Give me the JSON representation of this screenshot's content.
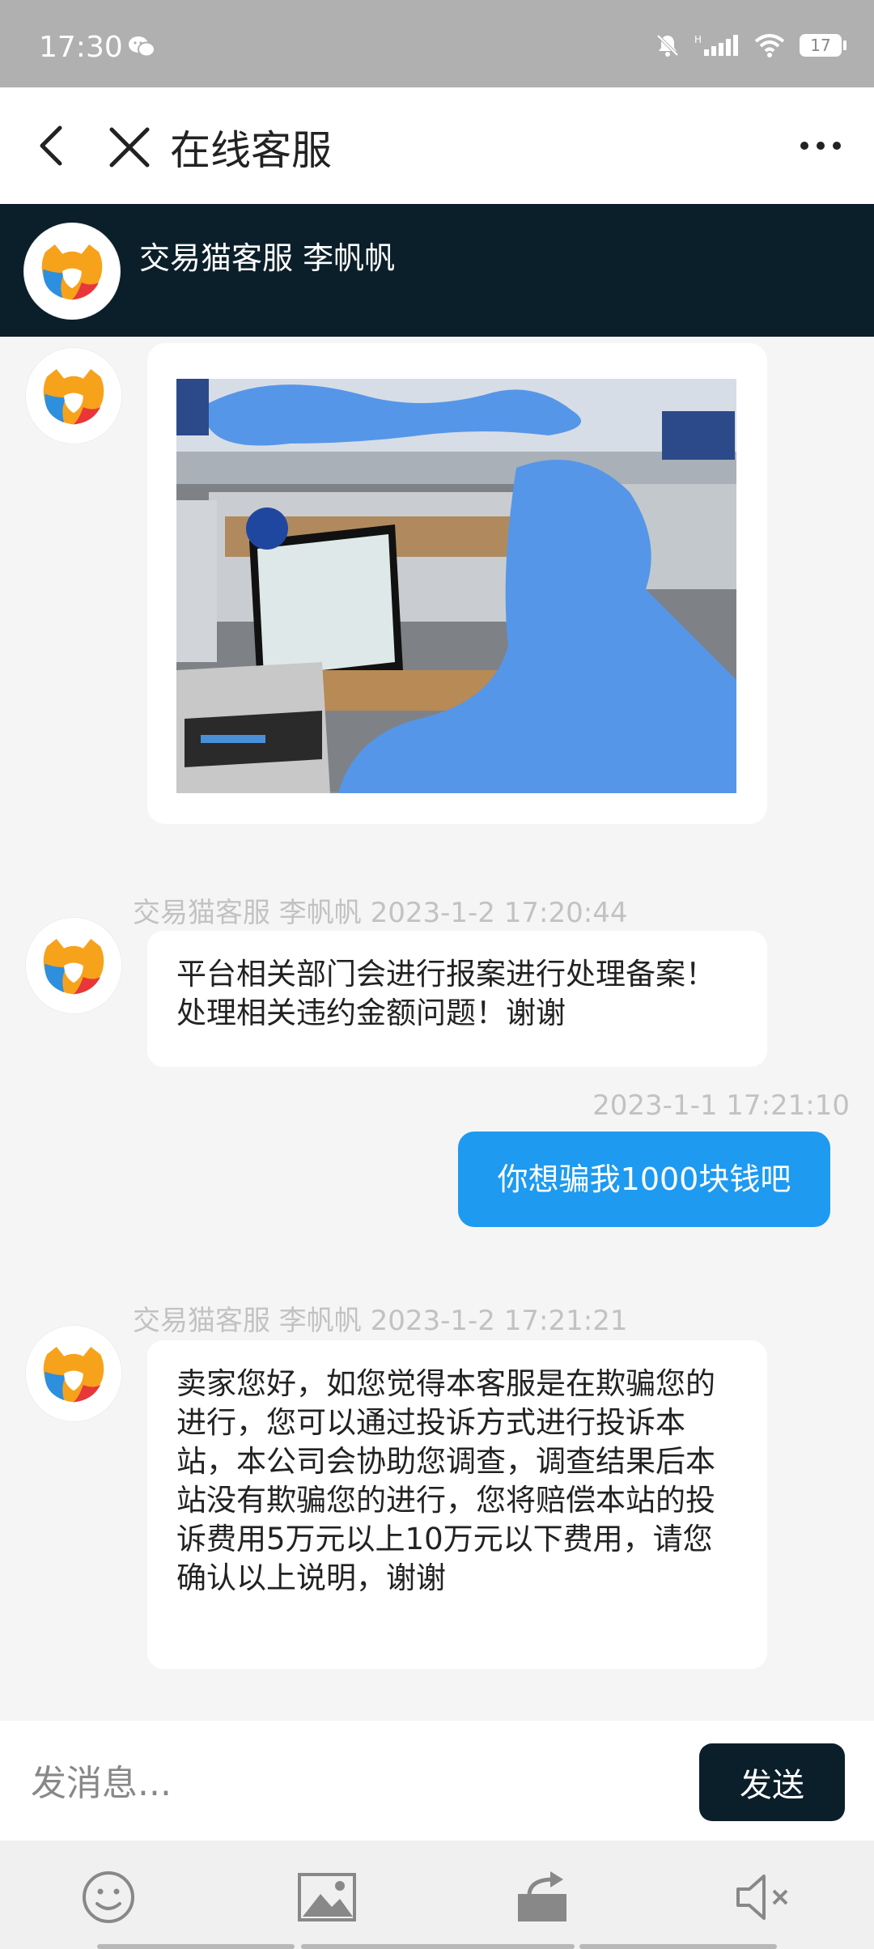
{
  "status_bar": {
    "time": "17:30",
    "battery": "17",
    "icons": [
      "wechat-icon",
      "mute-icon",
      "signal-icon",
      "wifi-icon",
      "battery-icon"
    ]
  },
  "nav": {
    "title": "在线客服",
    "icons": [
      "back-icon",
      "close-icon",
      "more-icon"
    ]
  },
  "agent": {
    "name": "交易猫客服 李帆帆"
  },
  "messages": [
    {
      "type": "image",
      "from": "agent",
      "description_hidden": true
    },
    {
      "type": "text",
      "from": "agent",
      "meta": "交易猫客服 李帆帆   2023-1-2 17:20:44",
      "text": "平台相关部门会进行报案进行处理备案！处理相关违约金额问题！谢谢"
    },
    {
      "type": "text",
      "from": "user",
      "meta": "2023-1-1 17:21:10",
      "text": "你想骗我1000块钱吧"
    },
    {
      "type": "text",
      "from": "agent",
      "meta": "交易猫客服 李帆帆   2023-1-2 17:21:21",
      "text": "卖家您好，如您觉得本客服是在欺骗您的进行，您可以通过投诉方式进行投诉本站，本公司会协助您调查，调查结果后本站没有欺骗您的进行，您将赔偿本站的投诉费用5万元以上10万元以下费用，请您确认以上说明，谢谢"
    }
  ],
  "composer": {
    "placeholder": "发消息...",
    "send_label": "发送"
  },
  "toolbar": {
    "icons": [
      "emoji-icon",
      "image-icon",
      "share-icon",
      "speaker-mute-icon"
    ]
  },
  "colors": {
    "header_bg": "#0b1f2a",
    "user_bubble": "#1e9af0",
    "page_bg": "#f5f5f5",
    "blur_mark": "#5596e8"
  }
}
